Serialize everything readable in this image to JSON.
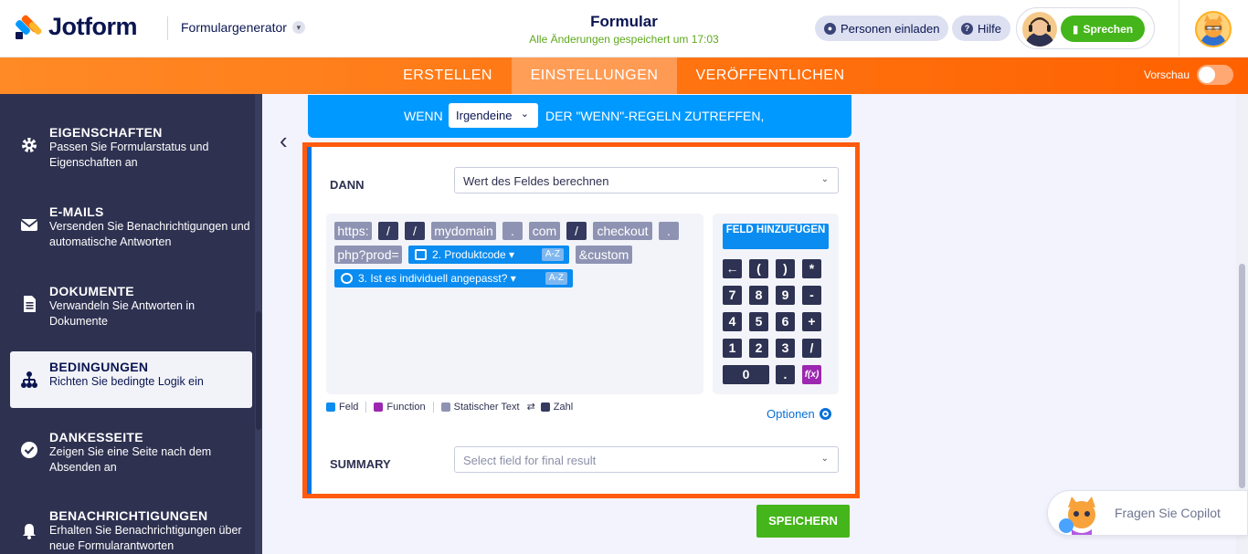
{
  "header": {
    "logo_text": "Jotform",
    "form_builder_label": "Formulargenerator",
    "title": "Formular",
    "saved_status": "Alle Änderungen gespeichert um 17:03",
    "invite_label": "Personen einladen",
    "help_label": "Hilfe",
    "speak_label": "Sprechen"
  },
  "nav": {
    "tabs": [
      {
        "label": "ERSTELLEN"
      },
      {
        "label": "EINSTELLUNGEN"
      },
      {
        "label": "VERÖFFENTLICHEN"
      }
    ],
    "active_tab": "EINSTELLUNGEN",
    "preview_label": "Vorschau"
  },
  "sidebar": {
    "items": [
      {
        "title": "EIGENSCHAFTEN",
        "desc": "Passen Sie Formularstatus und Eigenschaften an",
        "icon": "gear-icon"
      },
      {
        "title": "E-MAILS",
        "desc": "Versenden Sie Benachrichtigungen und automatische Antworten",
        "icon": "envelope-icon"
      },
      {
        "title": "DOKUMENTE",
        "desc": "Verwandeln Sie Antworten in Dokumente",
        "icon": "document-icon"
      },
      {
        "title": "BEDINGUNGEN",
        "desc": "Richten Sie bedingte Logik ein",
        "icon": "hierarchy-icon"
      },
      {
        "title": "DANKESSEITE",
        "desc": "Zeigen Sie eine Seite nach dem Absenden an",
        "icon": "check-circle-icon"
      },
      {
        "title": "BENACHRICHTIGUNGEN",
        "desc": "Erhalten Sie Benachrichtigungen über neue Formularantworten",
        "icon": "bell-icon"
      }
    ],
    "active": "BEDINGUNGEN"
  },
  "condition": {
    "if_label": "WENN",
    "if_select": "Irgendeine",
    "if_suffix": "DER \"WENN\"-REGELN ZUTREFFEN,",
    "then_label": "DANN",
    "then_select": "Wert des Feldes berechnen",
    "tokens": [
      "https:",
      "/",
      "/",
      "mydomain",
      ".",
      "com",
      "/",
      "checkout",
      ".",
      "php?prod=",
      "&custom"
    ],
    "field_tokens": [
      {
        "label": "2. Produktcode",
        "sort": "A-Z"
      },
      {
        "label": "3. Ist es individuell angepasst?",
        "sort": "A-Z"
      }
    ],
    "add_field_label": "FELD HINZUFÜGEN",
    "keys": [
      "←",
      "(",
      ")",
      "*",
      "7",
      "8",
      "9",
      "-",
      "4",
      "5",
      "6",
      "+",
      "1",
      "2",
      "3",
      "/",
      "0",
      ".",
      "f(x)"
    ],
    "legend": {
      "field": "Feld",
      "function": "Function",
      "static_text": "Statischer Text",
      "number": "Zahl"
    },
    "options_label": "Optionen",
    "summary_label": "SUMMARY",
    "summary_placeholder": "Select field for final result",
    "save_label": "SPEICHERN"
  },
  "copilot": {
    "label": "Fragen Sie Copilot"
  },
  "colors": {
    "orange": "#ff6100",
    "blue": "#0099ff",
    "field_blue": "#0a8cf0",
    "green": "#44b51a",
    "sidebar": "#2e3150",
    "function_purple": "#9c27b0",
    "static_gray": "#8f93b3",
    "number_dark": "#353a60"
  }
}
